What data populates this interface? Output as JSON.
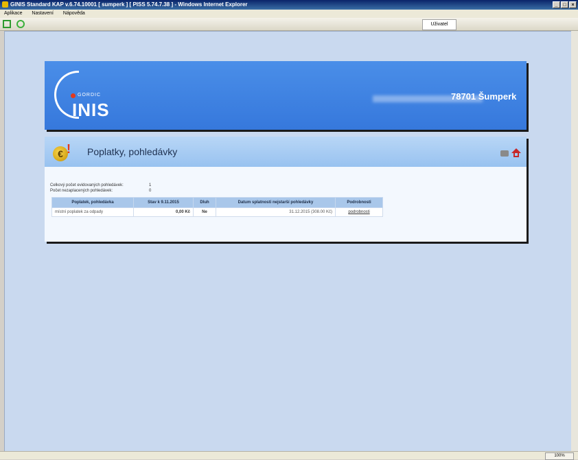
{
  "window": {
    "title": "GINIS Standard KAP v.6.74.10001 [ sumperk ] [ PISS 5.74.7.38 ] - Windows Internet Explorer",
    "buttons": [
      "_",
      "□",
      "×"
    ]
  },
  "menubar": {
    "items": [
      "Aplikace",
      "Nastavení",
      "Nápověda"
    ]
  },
  "toolbar": {
    "user_label": "Uživatel"
  },
  "statusbar": {
    "zoom": "100%"
  },
  "header": {
    "logo_small": "GORDIC",
    "logo_big": "INIS",
    "city": "78701 Šumperk"
  },
  "page": {
    "title": "Poplatky, pohledávky",
    "summary": [
      {
        "label": "Celkový počet evidovaných pohledávek:",
        "value": "1"
      },
      {
        "label": "Počet nezaplacených pohledávek:",
        "value": "0"
      }
    ],
    "table": {
      "headers": [
        "Poplatek, pohledávka",
        "Stav k 9.11.2015",
        "Dluh",
        "Datum splatnosti nejstarší pohledávky",
        "Podrobnosti"
      ],
      "rows": [
        [
          "místní poplatek za odpady",
          "0,00 Kč",
          "Ne",
          "31.12.2015 (308.00 Kč)",
          "podrobnosti"
        ]
      ]
    }
  },
  "colors": {
    "header_blue": "#3b7ddf",
    "page_background": "#c9d9ef",
    "table_header": "#a9c7ea",
    "accent_red": "#e23a1e"
  }
}
